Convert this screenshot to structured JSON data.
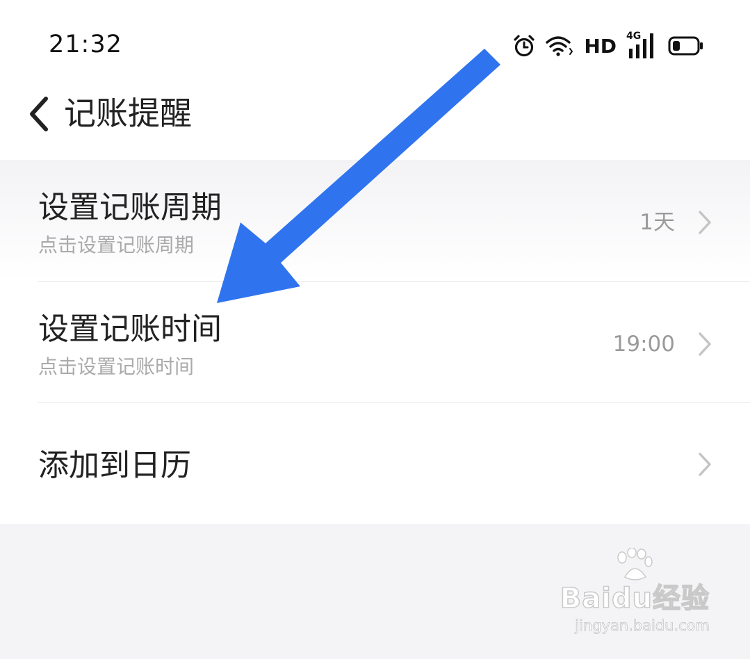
{
  "status_bar": {
    "time": "21:32",
    "hd_label": "HD",
    "network_label": "4G",
    "icons": [
      "alarm-icon",
      "wifi-icon",
      "cellular-signal-icon",
      "battery-icon"
    ]
  },
  "header": {
    "title": "记账提醒",
    "back_icon": "chevron-left-icon"
  },
  "settings": [
    {
      "title": "设置记账周期",
      "subtitle": "点击设置记账周期",
      "value": "1天"
    },
    {
      "title": "设置记账时间",
      "subtitle": "点击设置记账时间",
      "value": "19:00"
    },
    {
      "title": "添加到日历",
      "value": ""
    }
  ],
  "watermark": {
    "logo": "Baidu经验",
    "url": "jingyan.baidu.com"
  },
  "colors": {
    "annotation_arrow": "#2f74ee",
    "title_text": "#222222",
    "secondary_text": "#aaaaaa",
    "page_background": "#f4f4f6"
  }
}
